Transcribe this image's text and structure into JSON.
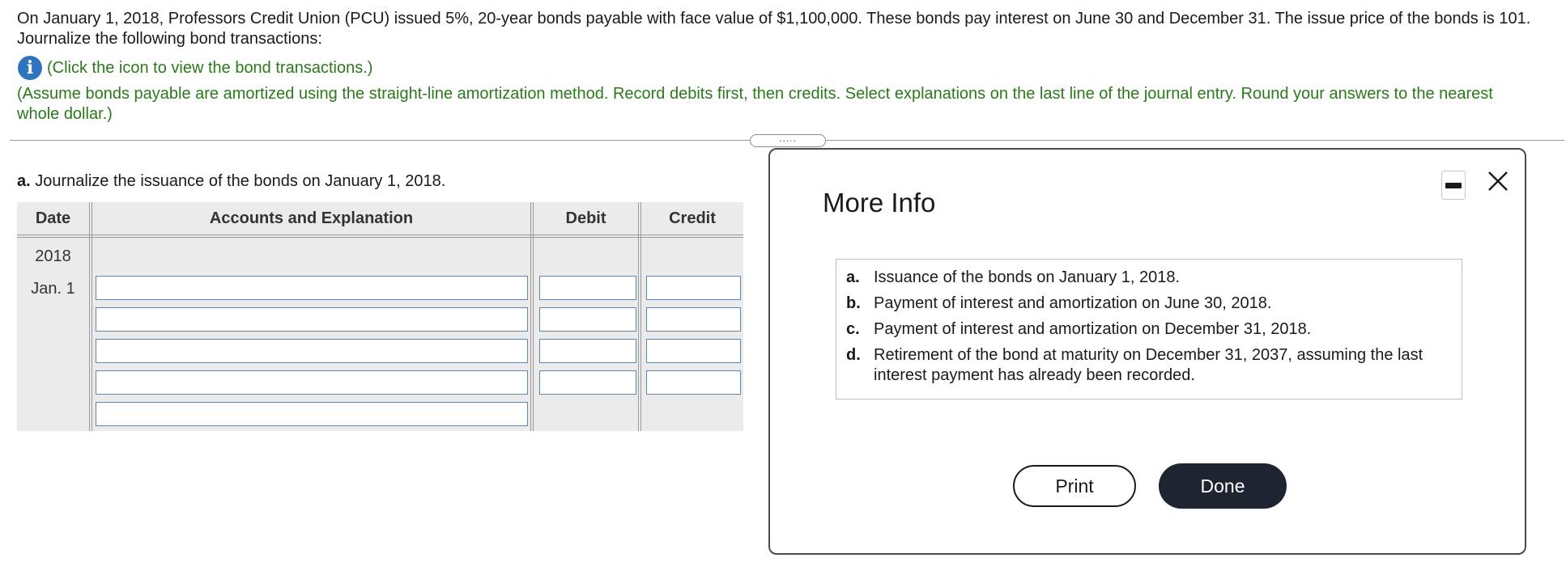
{
  "problem": {
    "text": "On January 1, 2018, Professors Credit Union (PCU) issued 5%, 20-year bonds payable with face value of $1,100,000. These bonds pay interest on June 30 and December 31. The issue price of the bonds is 101. Journalize the following bond transactions:",
    "info_link": "(Click the icon to view the bond transactions.)",
    "instructions": "(Assume bonds payable are amortized using the straight-line amortization method. Record debits first, then credits. Select explanations on the last line of the journal entry. Round your answers to the nearest whole dollar.)"
  },
  "splitter": {
    "dots": "....."
  },
  "part_a": {
    "letter": "a.",
    "text": "Journalize the issuance of the bonds on January 1, 2018."
  },
  "journal": {
    "headers": {
      "date": "Date",
      "accounts": "Accounts and Explanation",
      "debit": "Debit",
      "credit": "Credit"
    },
    "year": "2018",
    "date": "Jan. 1",
    "rows": [
      {
        "account": "",
        "debit": "",
        "credit": ""
      },
      {
        "account": "",
        "debit": "",
        "credit": ""
      },
      {
        "account": "",
        "debit": "",
        "credit": ""
      },
      {
        "account": "",
        "debit": "",
        "credit": ""
      },
      {
        "account": ""
      }
    ]
  },
  "modal": {
    "title": "More Info",
    "items": [
      {
        "letter": "a.",
        "text": "Issuance of the bonds on January 1, 2018."
      },
      {
        "letter": "b.",
        "text": "Payment of interest and amortization on June 30, 2018."
      },
      {
        "letter": "c.",
        "text": "Payment of interest and amortization on December 31, 2018."
      },
      {
        "letter": "d.",
        "text": "Retirement of the bond at maturity on December 31, 2037, assuming the last interest payment has already been recorded."
      }
    ],
    "print_label": "Print",
    "done_label": "Done"
  },
  "icons": {
    "info": "info-icon",
    "minimize": "minimize-icon",
    "close": "close-icon"
  },
  "colors": {
    "instruction_green": "#2a7a1a",
    "info_blue": "#2f74c0",
    "done_button": "#1e2530",
    "input_border": "#5a88b0"
  }
}
